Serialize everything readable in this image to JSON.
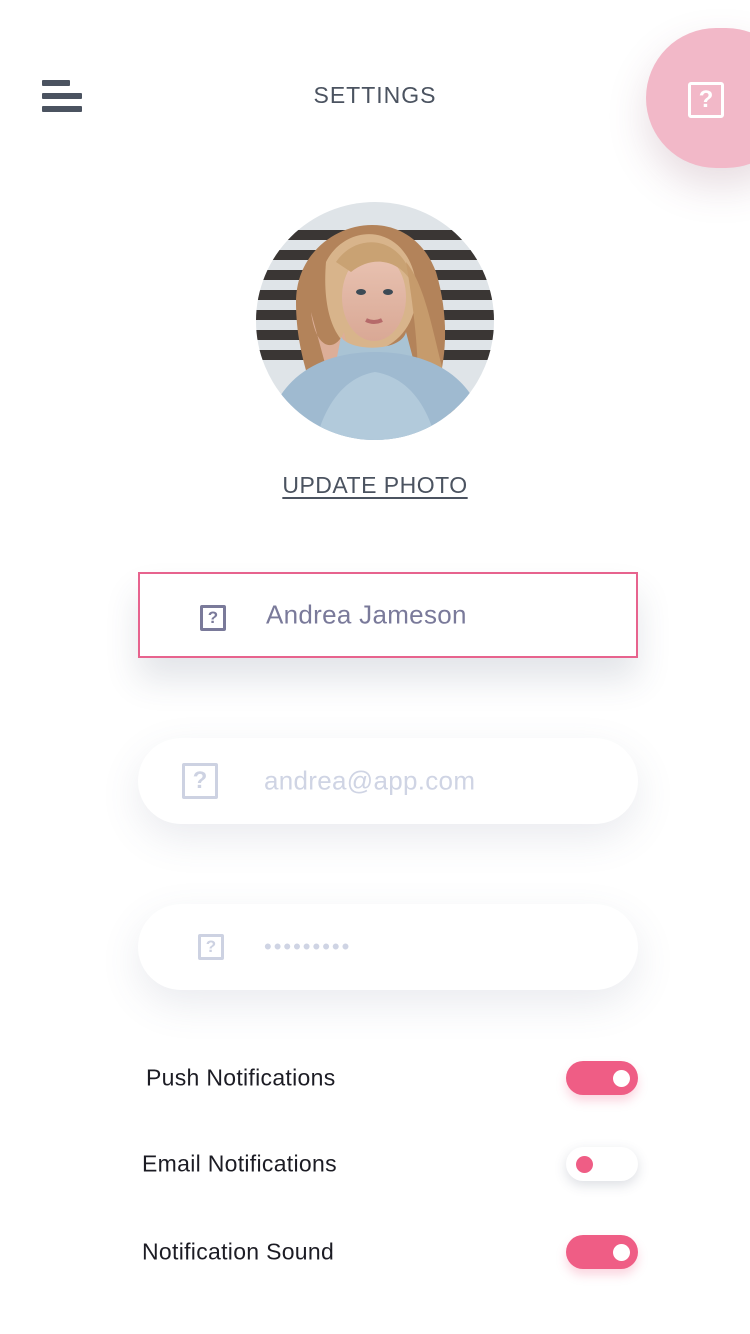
{
  "header": {
    "title": "SETTINGS",
    "help_icon_glyph": "?"
  },
  "profile": {
    "update_photo_label": "UPDATE PHOTO"
  },
  "fields": {
    "name": {
      "value": "Andrea Jameson",
      "icon": "question-icon",
      "icon_glyph": "?"
    },
    "email": {
      "placeholder": "andrea@app.com",
      "icon": "question-icon",
      "icon_glyph": "?"
    },
    "password": {
      "value": "•••••••••",
      "icon": "question-icon",
      "icon_glyph": "?"
    }
  },
  "settings": [
    {
      "label": "Push Notifications",
      "enabled": true
    },
    {
      "label": "Email Notifications",
      "enabled": false
    },
    {
      "label": "Notification Sound",
      "enabled": true
    }
  ],
  "colors": {
    "accent": "#ef5d85",
    "fab": "#f2b8c8",
    "text_dark": "#4b5360",
    "field_text": "#7a7a9a",
    "placeholder": "#cfd4e4"
  }
}
